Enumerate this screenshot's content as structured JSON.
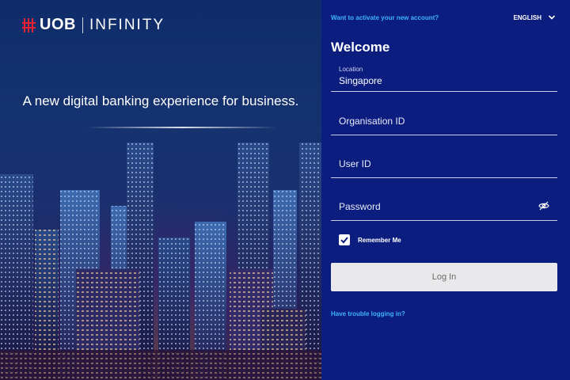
{
  "brand": {
    "name": "UOB",
    "product": "INFINITY",
    "accent": "#e3232f"
  },
  "hero": {
    "tagline": "A new digital banking experience for business."
  },
  "panel": {
    "activate_link": "Want to activate your new account?",
    "language": "ENGLISH",
    "welcome": "Welcome",
    "location": {
      "label": "Location",
      "value": "Singapore"
    },
    "organisation_id": {
      "placeholder": "Organisation ID"
    },
    "user_id": {
      "placeholder": "User ID"
    },
    "password": {
      "placeholder": "Password",
      "toggle_icon": "eye-slash-icon"
    },
    "remember_me": {
      "label": "Remember Me",
      "checked": true
    },
    "login_label": "Log In",
    "trouble_link": "Have trouble logging in?",
    "colors": {
      "panel_bg": "#0b1d7f",
      "link": "#3fb3ff",
      "button_bg": "#e9e9ec"
    }
  }
}
